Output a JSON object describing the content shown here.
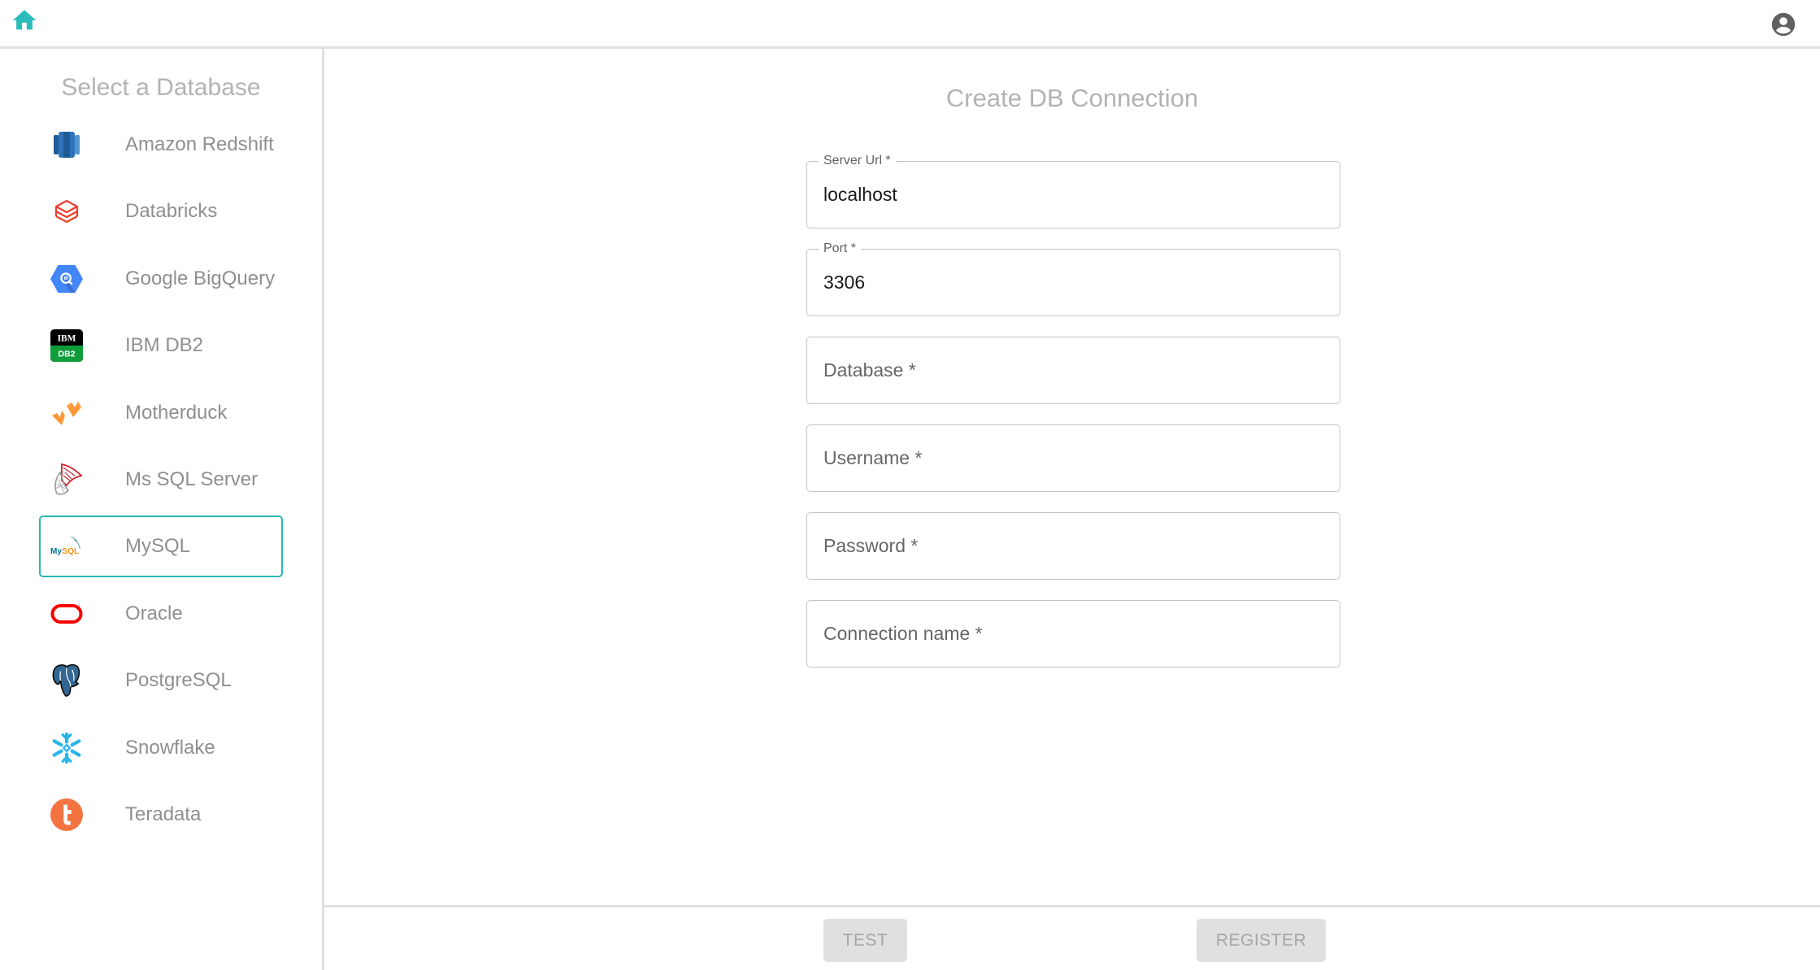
{
  "header": {
    "home_icon": "home-icon",
    "user_icon": "account-circle-icon",
    "accent_color": "#2bbbbb"
  },
  "sidebar": {
    "title": "Select a Database",
    "selected": "MySQL",
    "items": [
      {
        "label": "Amazon Redshift",
        "icon": "amazon-redshift-icon"
      },
      {
        "label": "Databricks",
        "icon": "databricks-icon"
      },
      {
        "label": "Google BigQuery",
        "icon": "google-bigquery-icon"
      },
      {
        "label": "IBM DB2",
        "icon": "ibm-db2-icon"
      },
      {
        "label": "Motherduck",
        "icon": "motherduck-icon"
      },
      {
        "label": "Ms SQL Server",
        "icon": "ms-sql-server-icon"
      },
      {
        "label": "MySQL",
        "icon": "mysql-icon"
      },
      {
        "label": "Oracle",
        "icon": "oracle-icon"
      },
      {
        "label": "PostgreSQL",
        "icon": "postgresql-icon"
      },
      {
        "label": "Snowflake",
        "icon": "snowflake-icon"
      },
      {
        "label": "Teradata",
        "icon": "teradata-icon"
      }
    ]
  },
  "form": {
    "title": "Create DB Connection",
    "fields": [
      {
        "label": "Server Url *",
        "value": "localhost"
      },
      {
        "label": "Port *",
        "value": "3306"
      },
      {
        "label": "Database *",
        "value": ""
      },
      {
        "label": "Username *",
        "value": ""
      },
      {
        "label": "Password *",
        "value": ""
      },
      {
        "label": "Connection name *",
        "value": ""
      }
    ]
  },
  "footer": {
    "test_label": "TEST",
    "register_label": "REGISTER"
  }
}
